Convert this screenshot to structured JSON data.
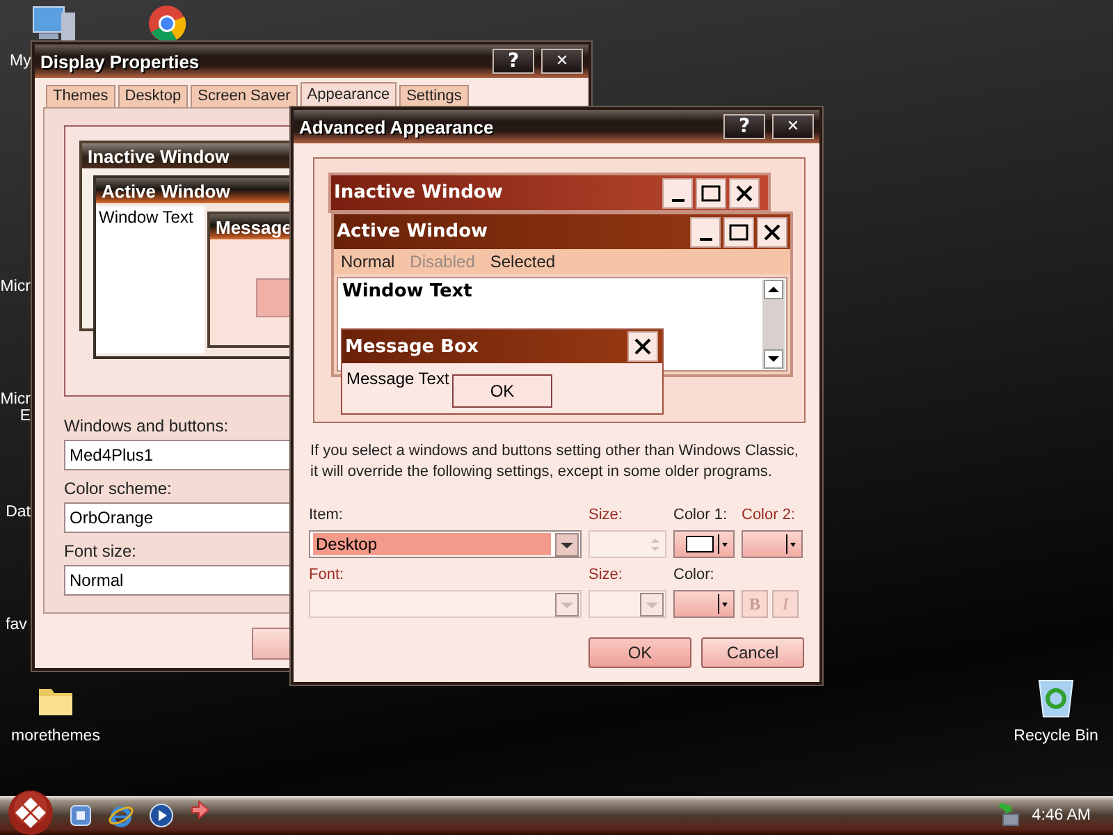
{
  "desktop_icons": [
    {
      "kind": "computer",
      "label": "My"
    },
    {
      "kind": "browser"
    },
    {
      "kind": "covered",
      "label": "Micr"
    },
    {
      "kind": "covered",
      "label": "Micr",
      "label_2": "E"
    },
    {
      "kind": "covered",
      "label": "Dat"
    },
    {
      "kind": "covered",
      "label": "fav"
    },
    {
      "kind": "folder",
      "label": "morethemes"
    },
    {
      "kind": "recycle",
      "label": "Recycle Bin"
    }
  ],
  "display_properties": {
    "title": "Display Properties",
    "title_buttons": [
      "?",
      "✕"
    ],
    "tabs": [
      {
        "label": "Themes",
        "selected": false
      },
      {
        "label": "Desktop",
        "selected": false
      },
      {
        "label": "Screen Saver",
        "selected": false
      },
      {
        "label": "Appearance",
        "selected": true
      },
      {
        "label": "Settings",
        "selected": false
      }
    ],
    "preview": {
      "inactive_title": "Inactive Window",
      "active_title": "Active Window",
      "window_text": "Window Text",
      "message_title": "Message"
    },
    "fields": [
      {
        "label": "Windows and buttons:",
        "value": "Med4Plus1"
      },
      {
        "label": "Color scheme:",
        "value": "OrbOrange"
      },
      {
        "label": "Font size:",
        "value": "Normal"
      }
    ]
  },
  "advanced_appearance": {
    "title": "Advanced Appearance",
    "title_buttons": [
      "?",
      "✕"
    ],
    "preview": {
      "inactive_title": "Inactive Window",
      "active_title": "Active Window",
      "menu": [
        {
          "label": "Normal",
          "disabled": false
        },
        {
          "label": "Disabled",
          "disabled": true
        },
        {
          "label": "Selected",
          "disabled": false
        }
      ],
      "window_text": "Window Text",
      "message_title": "Message Box",
      "message_text": "Message Text",
      "ok": "OK"
    },
    "info": "If you select a windows and buttons setting other than Windows Classic,\nit will override the following settings, except in some older programs.",
    "rows": [
      {
        "main": {
          "label": "Item:",
          "disabled": false,
          "value": "Desktop"
        },
        "size": {
          "label": "Size:",
          "disabled": true,
          "kind": "spinner"
        },
        "colors": [
          {
            "label": "Color 1:",
            "disabled": false,
            "color": "#ffffff"
          },
          {
            "label": "Color 2:",
            "disabled": true
          }
        ]
      },
      {
        "main": {
          "label": "Font:",
          "disabled": true
        },
        "size": {
          "label": "Size:",
          "disabled": true,
          "kind": "dropdown"
        },
        "colors": [
          {
            "label": "Color:",
            "disabled": false
          }
        ],
        "style_buttons": [
          {
            "label": "B",
            "kind": "bold",
            "disabled": true
          },
          {
            "label": "I",
            "kind": "italic",
            "disabled": true
          }
        ]
      }
    ],
    "buttons": [
      "OK",
      "Cancel"
    ]
  },
  "taskbar": {
    "clock": "4:46 AM"
  }
}
